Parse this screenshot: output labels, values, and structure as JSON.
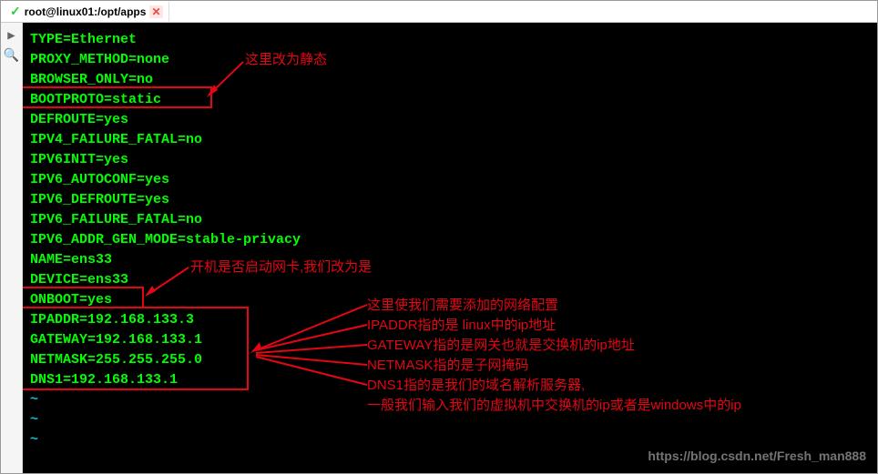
{
  "tab": {
    "title": "root@linux01:/opt/apps"
  },
  "config": {
    "l0": "TYPE=Ethernet",
    "l1": "PROXY_METHOD=none",
    "l2": "BROWSER_ONLY=no",
    "l3": "BOOTPROTO=static",
    "l4": "DEFROUTE=yes",
    "l5": "IPV4_FAILURE_FATAL=no",
    "l6": "IPV6INIT=yes",
    "l7": "IPV6_AUTOCONF=yes",
    "l8": "IPV6_DEFROUTE=yes",
    "l9": "IPV6_FAILURE_FATAL=no",
    "l10": "IPV6_ADDR_GEN_MODE=stable-privacy",
    "l11": "NAME=ens33",
    "l12": "DEVICE=ens33",
    "l13": "ONBOOT=yes",
    "l14": "IPADDR=192.168.133.3",
    "l15": "GATEWAY=192.168.133.1",
    "l16": "NETMASK=255.255.255.0",
    "l17": "DNS1=192.168.133.1"
  },
  "tildes": {
    "t0": "~",
    "t1": "~",
    "t2": "~"
  },
  "annotations": {
    "static_note": "这里改为静态",
    "onboot_note": "开机是否启动网卡,我们改为是",
    "network_header": "这里使我们需要添加的网络配置",
    "ipaddr_note": "IPADDR指的是 linux中的ip地址",
    "gateway_note": "GATEWAY指的是网关也就是交换机的ip地址",
    "netmask_note": "NETMASK指的是子网掩码",
    "dns1_note": "DNS1指的是我们的域名解析服务器,",
    "dns1_extra": "一般我们输入我们的虚拟机中交换机的ip或者是windows中的ip"
  },
  "watermark": "https://blog.csdn.net/Fresh_man888"
}
